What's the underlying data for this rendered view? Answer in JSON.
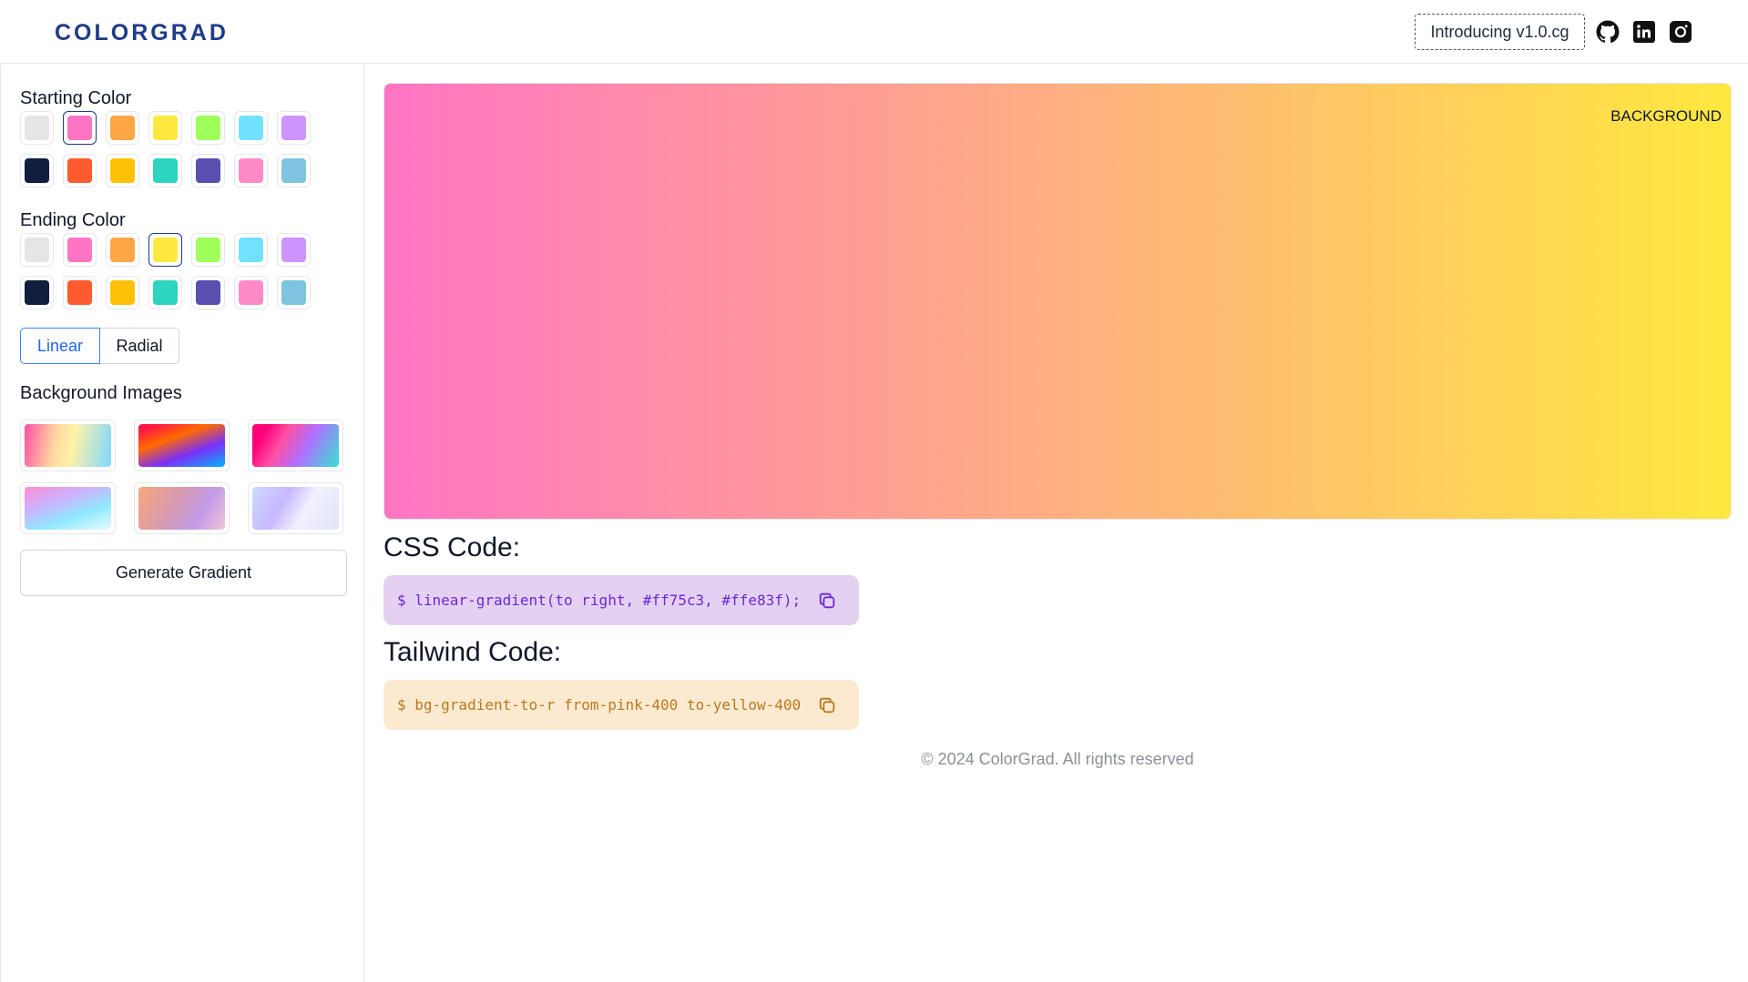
{
  "header": {
    "logo": "COLORGRAD",
    "intro_label": "Introducing v1.0.cg",
    "social": [
      "github-icon",
      "linkedin-icon",
      "instagram-icon"
    ]
  },
  "sidebar": {
    "starting_label": "Starting Color",
    "ending_label": "Ending Color",
    "colors": [
      "#e5e5e5",
      "#ff75c3",
      "#ffa647",
      "#ffe83f",
      "#9fff5b",
      "#70e2ff",
      "#cd93ff",
      "#0f1f3d",
      "#ff5b2e",
      "#ffc107",
      "#2dd4bf",
      "#5b4fb0",
      "#ff8ac8",
      "#7ec4e0"
    ],
    "starting_selected": "#ff75c3",
    "ending_selected": "#ffe83f",
    "gradient_types": {
      "linear": "Linear",
      "radial": "Radial",
      "active": "Linear"
    },
    "bg_images_label": "Background Images",
    "bg_images": [
      "linear-gradient(100deg, #ff4fa3 0%, #ffd6a0 35%, #fdf3a8 55%, #7fd7ff 100%)",
      "linear-gradient(160deg, #ff1744 10%, #ff6a00 35%, #7b2ff7 65%, #00b4ff 100%)",
      "linear-gradient(120deg, #ff007a 15%, #ff4fa3 35%, #b06fff 60%, #36e4d0 100%)",
      "linear-gradient(160deg, #ff8bd4 0%, #c9b5ff 35%, #8fe9ff 65%, #e9fbff 100%)",
      "linear-gradient(120deg, #f7a77a 0%, #d99aae 40%, #c19be8 70%, #f0c4d8 100%)",
      "linear-gradient(120deg, #cdd9ff 0%, #c8b8ff 35%, #f2f0ff 60%, #dfe6f7 100%)"
    ],
    "generate_label": "Generate Gradient"
  },
  "main": {
    "preview_label": "BACKGROUND",
    "preview_gradient": "linear-gradient(to right, #ff75c3, #ffe83f)",
    "css_title": "CSS Code:",
    "css_code": "$ linear-gradient(to right, #ff75c3, #ffe83f);",
    "tailwind_title": "Tailwind Code:",
    "tailwind_code": "$ bg-gradient-to-r from-pink-400 to-yellow-400",
    "footer": "© 2024 ColorGrad. All rights reserved"
  },
  "theme": {
    "logo_color": "#1e3a8a",
    "accent": "#2563eb"
  }
}
